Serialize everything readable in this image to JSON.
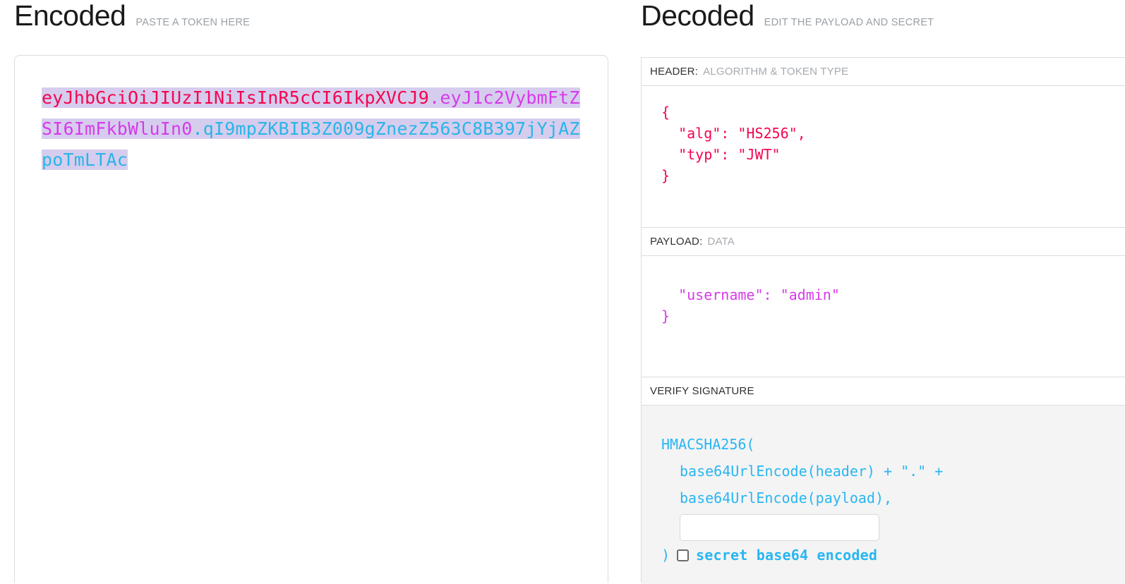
{
  "encoded": {
    "title": "Encoded",
    "subtitle": "PASTE A TOKEN HERE",
    "token": {
      "header_segment": "eyJhbGciOiJIUzI1NiIsInR5cCI6IkpXVCJ9",
      "dot_1": ".",
      "payload_segment": "eyJ1c2VybmFtZSI6ImFkbWluIn0",
      "dot_2": ".",
      "signature_segment": "qI9mpZKBIB3Z009gZnezZ563C8B397jYjAZpoTmLTAc",
      "selected": true
    },
    "colors": {
      "header": "#f5054f",
      "payload": "#d63aea",
      "signature": "#2ab5e8",
      "selection_highlight": "#d6cdee"
    }
  },
  "decoded": {
    "title": "Decoded",
    "subtitle": "EDIT THE PAYLOAD AND SECRET",
    "header_section": {
      "label": "HEADER:",
      "sublabel": "ALGORITHM & TOKEN TYPE",
      "json": "{\n  \"alg\": \"HS256\",\n  \"typ\": \"JWT\"\n}",
      "color": "#f5054f"
    },
    "payload_section": {
      "label": "PAYLOAD:",
      "sublabel": "DATA",
      "json": "  \"username\": \"admin\"\n}",
      "color": "#d63aea"
    },
    "signature_section": {
      "label": "VERIFY SIGNATURE",
      "sublabel": "",
      "line_1": "HMACSHA256(",
      "line_2": "base64UrlEncode(header) + \".\" +",
      "line_3": "base64UrlEncode(payload),",
      "closing_paren": ")",
      "secret_value": "",
      "secret_placeholder": "",
      "base64_checkbox_label": "secret base64 encoded",
      "base64_checked": false,
      "color": "#29b6f2"
    }
  }
}
